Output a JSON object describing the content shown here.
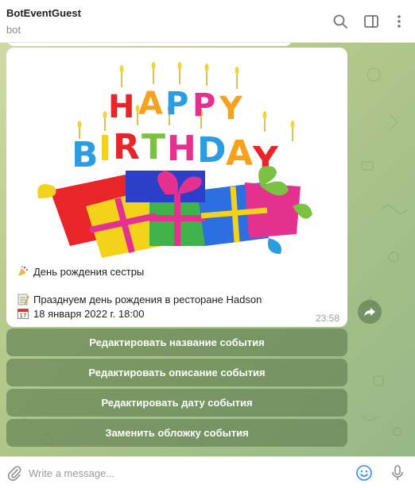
{
  "header": {
    "title": "BotEventGuest",
    "subtitle": "bot"
  },
  "message": {
    "title_line": "День рождения сестры",
    "description_line": "Празднуем день рождения в ресторане Hadson",
    "date_line": "18 января 2022 г. 18:00",
    "time": "23:58",
    "image": {
      "banner_letters_top": [
        "H",
        "A",
        "P",
        "P",
        "Y"
      ],
      "banner_letters_bottom": [
        "B",
        "I",
        "R",
        "T",
        "H",
        "D",
        "A",
        "Y"
      ],
      "letter_colors": [
        "#e8262a",
        "#f7a21b",
        "#2c9de0",
        "#7cc242",
        "#e4308f",
        "#f3d21c",
        "#4b3fa8",
        "#1ea6a3"
      ]
    },
    "icons": {
      "title": "party-popper-icon",
      "description": "memo-icon",
      "date": "calendar-icon"
    }
  },
  "keyboard": {
    "buttons": [
      "Редактировать название события",
      "Редактировать описание события",
      "Редактировать дату события",
      "Заменить обложку события"
    ]
  },
  "composer": {
    "placeholder": "Write a message..."
  },
  "colors": {
    "accent": "#3390ec",
    "keyboard_button": "#5c7a4e",
    "emoji_button": "#3390ec"
  }
}
